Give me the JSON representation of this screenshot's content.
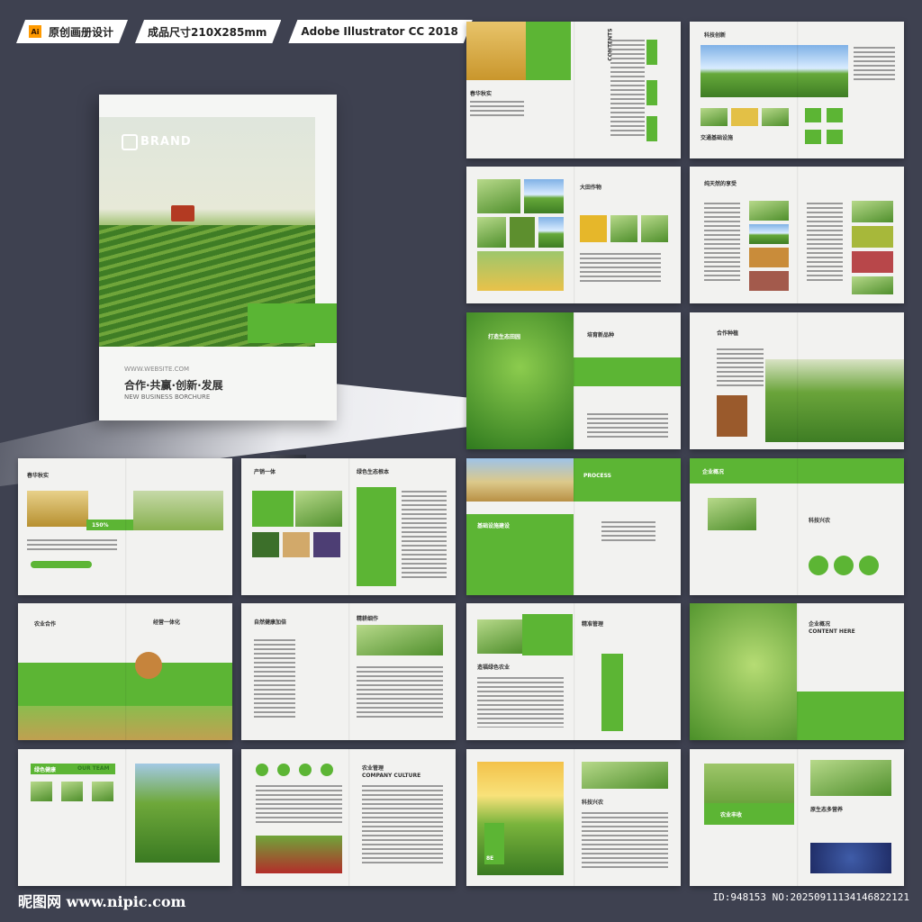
{
  "header": {
    "ai_badge": "Ai",
    "tag1": "原创画册设计",
    "tag2": "成品尺寸210X285mm",
    "tag3": "Adobe Illustrator CC 2018"
  },
  "cover": {
    "brand": "BRAND",
    "website": "WWW.WEBSITE.COM",
    "slogan": "合作·共赢·创新·发展",
    "subtitle": "NEW BUSINESS BORCHURE"
  },
  "spreads": [
    {
      "t1": "春华秋实",
      "t2": "CONTENTS"
    },
    {
      "t1": "科技创新",
      "t2": "交通基础设施"
    },
    {
      "t1": "大田作物",
      "t2": ""
    },
    {
      "t1": "纯天然的享受",
      "t2": "ENTERPRISE BRAND"
    },
    {
      "t1": "打造生态田园",
      "t2": "培育新品种"
    },
    {
      "t1": "合作种植",
      "t2": "STRATEGIC COOPERATION"
    },
    {
      "t1": "春华秋实",
      "t2": "150%"
    },
    {
      "t1": "产销一体",
      "t2": "绿色生态根本"
    },
    {
      "t1": "PROCESS",
      "t2": "基础设施建设"
    },
    {
      "t1": "企业概况",
      "t2": "科技兴农"
    },
    {
      "t1": "农业合作",
      "t2": "经营一体化"
    },
    {
      "t1": "自然健康加倍",
      "t2": "精耕细作"
    },
    {
      "t1": "造福绿色农业",
      "t2": "精准管理"
    },
    {
      "t1": "企业概况",
      "t2": "CONTENT HERE"
    },
    {
      "t1": "绿色健康",
      "t2": "OUR TEAM"
    },
    {
      "t1": "农业管理",
      "t2": "COMPANY CULTURE"
    },
    {
      "t1": "科技兴农",
      "t2": "8E"
    },
    {
      "t1": "农业丰收",
      "t2": "原生态多营养"
    }
  ],
  "footer": {
    "logo": "昵图网 www.nipic.com",
    "id": "ID:948153 NO:20250911134146822121"
  }
}
